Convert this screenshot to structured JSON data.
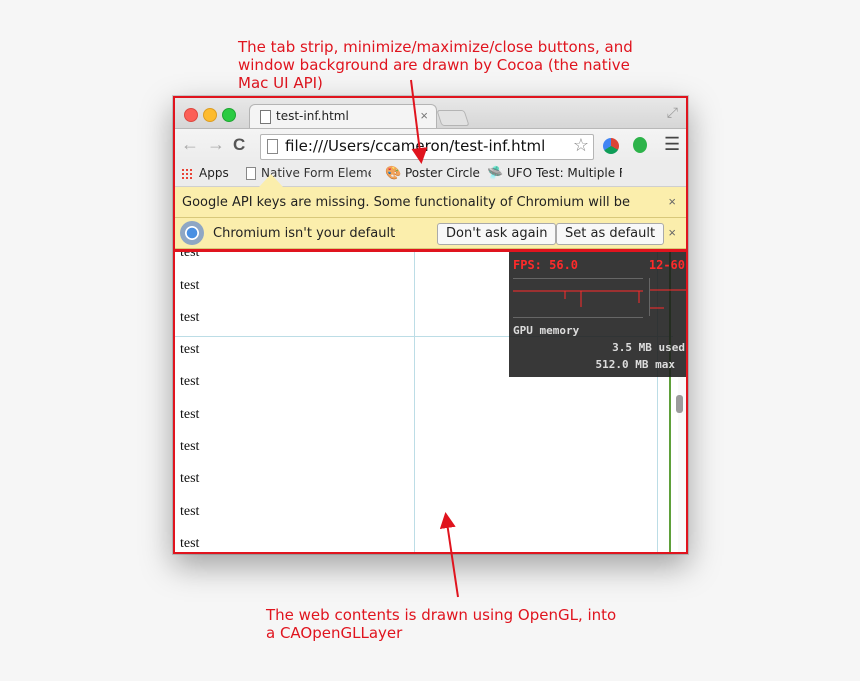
{
  "annotations": {
    "top": "The tab strip, minimize/maximize/close buttons, and window background are drawn by Cocoa (the native Mac UI API)",
    "bottom": "The web contents is drawn using OpenGL, into a CAOpenGLLayer"
  },
  "tab": {
    "title": "test-inf.html",
    "close": "×"
  },
  "omnibox": {
    "url": "file:///Users/ccameron/test-inf.html"
  },
  "bookmarks": [
    {
      "label": "Apps"
    },
    {
      "label": "Native Form Element"
    },
    {
      "label": "Poster Circle"
    },
    {
      "label": "UFO Test: Multiple F"
    }
  ],
  "infobars": {
    "api_keys": "Google API keys are missing. Some functionality of Chromium will be",
    "default_browser": "Chromium isn't your default",
    "dont_ask": "Don't ask again",
    "set_default": "Set as default",
    "close": "×"
  },
  "content": {
    "rows": [
      "test",
      "test",
      "test",
      "test",
      "test",
      "test",
      "test",
      "test",
      "test",
      "test"
    ]
  },
  "hud": {
    "fps": "FPS: 56.0",
    "range": "12-60",
    "memory_title": "GPU memory",
    "used": "3.5 MB used",
    "max": "512.0 MB max"
  },
  "colors": {
    "annotation": "#e0141e",
    "infobar": "#fbeeac",
    "hud_text": "#ff2a2a"
  }
}
